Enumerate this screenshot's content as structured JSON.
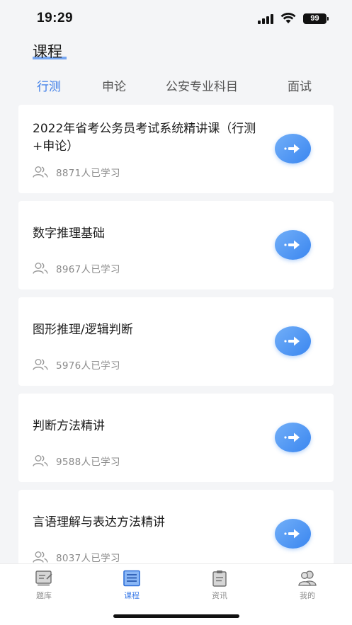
{
  "status_bar": {
    "time": "19:29",
    "battery": "99"
  },
  "header": {
    "title": "课程"
  },
  "tabs": [
    {
      "label": "行测",
      "active": true
    },
    {
      "label": "申论",
      "active": false
    },
    {
      "label": "公安专业科目",
      "active": false
    },
    {
      "label": "面试",
      "active": false
    }
  ],
  "courses": [
    {
      "title": "2022年省考公务员考试系统精讲课（行测+申论）",
      "learners": "8871人已学习"
    },
    {
      "title": "数字推理基础",
      "learners": "8967人已学习"
    },
    {
      "title": "图形推理/逻辑判断",
      "learners": "5976人已学习"
    },
    {
      "title": "判断方法精讲",
      "learners": "9588人已学习"
    },
    {
      "title": "言语理解与表达方法精讲",
      "learners": "8037人已学习"
    }
  ],
  "tab_bar": {
    "items": [
      {
        "label": "题库",
        "icon": "question-bank-icon",
        "active": false
      },
      {
        "label": "课程",
        "icon": "course-list-icon",
        "active": true
      },
      {
        "label": "资讯",
        "icon": "news-clipboard-icon",
        "active": false
      },
      {
        "label": "我的",
        "icon": "profile-icon",
        "active": false
      }
    ]
  },
  "colors": {
    "accent": "#3f7ee8",
    "background": "#f4f5f7",
    "card": "#ffffff"
  }
}
